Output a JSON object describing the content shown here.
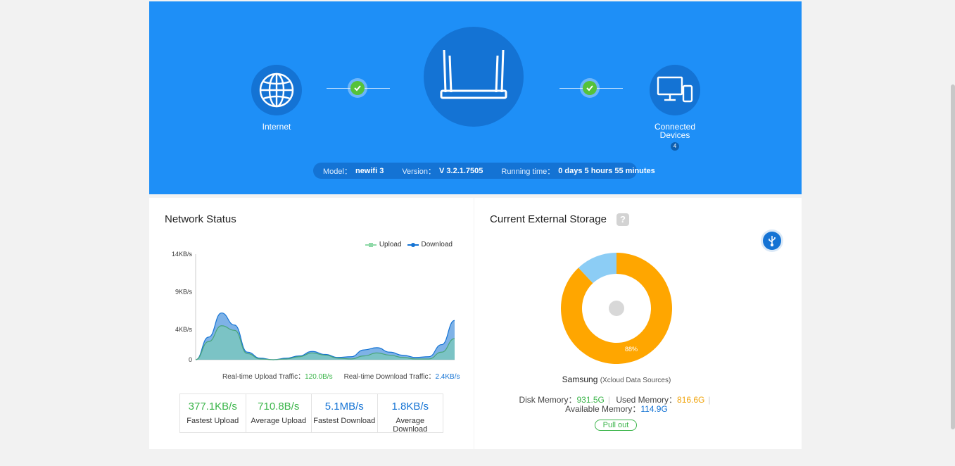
{
  "hero": {
    "internet_label": "Internet",
    "devices_label": "Connected Devices",
    "device_count": "4",
    "model_label": "Model：",
    "model_value": "newifi 3",
    "version_label": "Version：",
    "version_value": "V 3.2.1.7505",
    "running_label": "Running time：",
    "running_value": "0 days 5 hours 55 minutes"
  },
  "network": {
    "title": "Network Status",
    "legend_upload": "Upload",
    "legend_download": "Download",
    "upload_traffic_label": "Real-time Upload Traffic：",
    "upload_traffic_value": "120.0B/s",
    "download_traffic_label": "Real-time Download Traffic：",
    "download_traffic_value": "2.4KB/s",
    "stats": [
      {
        "value": "377.1KB/s",
        "label": "Fastest Upload"
      },
      {
        "value": "710.8B/s",
        "label": "Average Upload"
      },
      {
        "value": "5.1MB/s",
        "label": "Fastest Download"
      },
      {
        "value": "1.8KB/s",
        "label": "Average Download"
      }
    ]
  },
  "chart_data": {
    "type": "area",
    "title": "",
    "xlabel": "",
    "ylabel": "",
    "y_ticks": [
      "14KB/s",
      "9KB/s",
      "4KB/s",
      "0"
    ],
    "ylim": [
      0,
      14
    ],
    "x": [
      0,
      1,
      2,
      3,
      4,
      5,
      6,
      7,
      8,
      9,
      10,
      11,
      12,
      13,
      14,
      15,
      16,
      17,
      18,
      19,
      20
    ],
    "series": [
      {
        "name": "Upload",
        "color": "#8fd9a8",
        "values": [
          0.0,
          2.4,
          4.5,
          3.9,
          0.8,
          0.1,
          0.0,
          0.1,
          0.4,
          0.9,
          0.6,
          0.2,
          0.1,
          0.5,
          0.9,
          0.6,
          0.3,
          0.1,
          0.1,
          1.0,
          2.8
        ]
      },
      {
        "name": "Download",
        "color": "#1473d4",
        "values": [
          0.0,
          3.0,
          6.2,
          4.6,
          1.0,
          0.2,
          0.0,
          0.2,
          0.5,
          1.1,
          0.7,
          0.3,
          0.4,
          1.3,
          1.6,
          1.0,
          0.6,
          0.3,
          0.4,
          2.0,
          5.2
        ]
      }
    ],
    "grid": false,
    "legend": "top-right"
  },
  "storage": {
    "title": "Current External Storage",
    "help": "?",
    "used_percent": 88,
    "percent_label": "88%",
    "colors": {
      "used": "#ffa600",
      "available": "#8ccdf5",
      "center": "#d8d8d8"
    },
    "disk_name": "Samsung",
    "disk_source": "(Xcloud Data Sources)",
    "disk_memory_label": "Disk Memory：",
    "disk_memory_value": "931.5G",
    "used_memory_label": "Used Memory：",
    "used_memory_value": "816.6G",
    "available_memory_label": "Available Memory：",
    "available_memory_value": "114.9G",
    "pull_out": "Pull out"
  }
}
